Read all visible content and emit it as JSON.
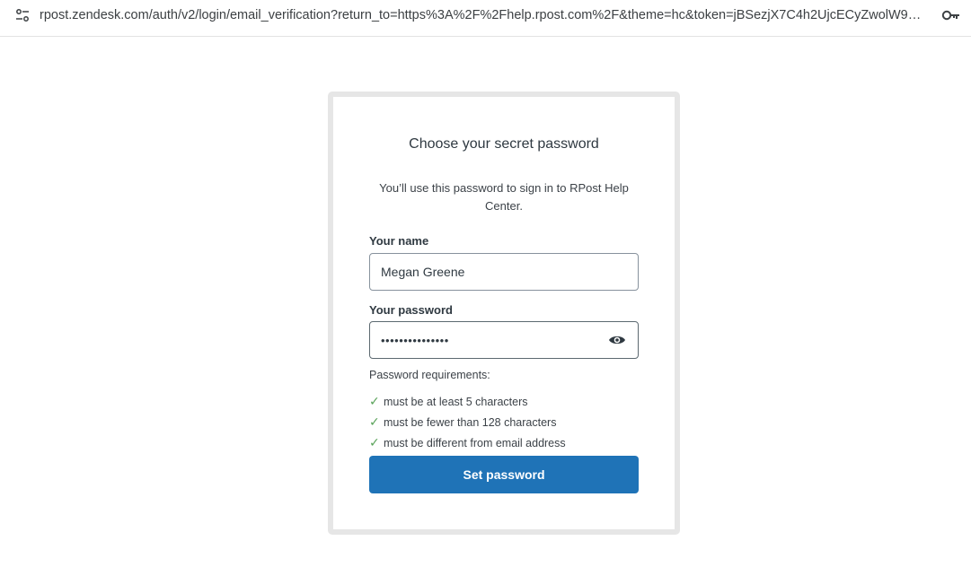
{
  "browser": {
    "url": "rpost.zendesk.com/auth/v2/login/email_verification?return_to=https%3A%2F%2Fhelp.rpost.com%2F&theme=hc&token=jBSezjX7C4h2UjcECyZwolW9MNwO33..."
  },
  "form": {
    "title": "Choose your secret password",
    "subtitle": "You’ll use this password to sign in to RPost Help Center.",
    "name_label": "Your name",
    "name_value": "Megan Greene",
    "password_label": "Your password",
    "password_value": "•••••••••••••••",
    "requirements_title": "Password requirements:",
    "requirements": [
      "must be at least 5 characters",
      "must be fewer than 128 characters",
      "must be different from email address"
    ],
    "check_mark": "✓",
    "submit_label": "Set password"
  },
  "colors": {
    "button": "#1f73b7",
    "check": "#5aa35a",
    "card_border": "#e6e6e6"
  },
  "icons": {
    "site_info": "site-settings-icon",
    "key": "key-icon",
    "eye": "eye-icon"
  }
}
